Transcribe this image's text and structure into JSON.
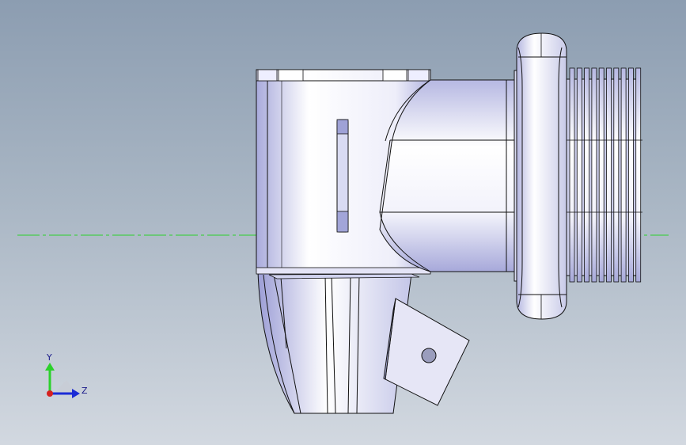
{
  "viewport": {
    "background_top": "#8c9db1",
    "background_bottom": "#d2d8e0",
    "centerline_color": "#2bd12b"
  },
  "model": {
    "body_color": "#f2f2fa",
    "shade_color": "#b9bbe0",
    "edge_color": "#111111"
  },
  "triad": {
    "y_label": "Y",
    "z_label": "Z",
    "y_color": "#2bd12b",
    "z_color": "#1a2bd6",
    "x_color": "#d62020"
  }
}
